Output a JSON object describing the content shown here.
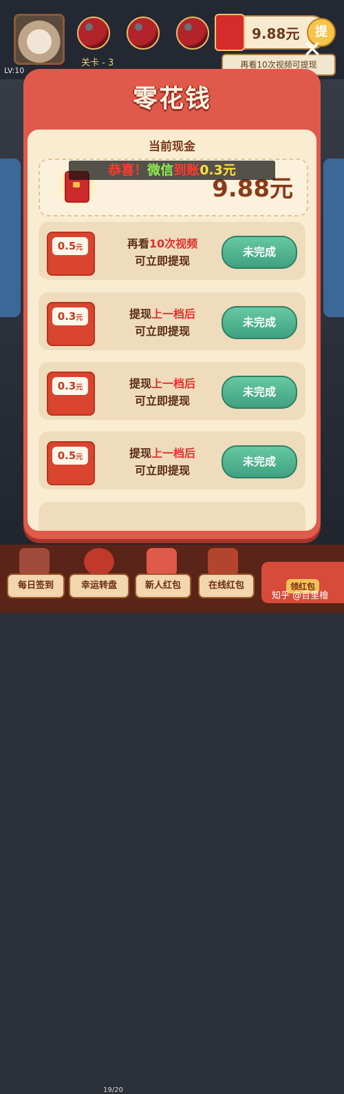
{
  "background": {
    "level": "LV:10",
    "stage": "关卡 - 3",
    "cash": "9.88元",
    "cash_tile": "提",
    "watch_note": "再看10次视频可提现",
    "progress": "19/20",
    "bottom_nav": [
      {
        "label": "每日签到"
      },
      {
        "label": "幸运转盘"
      },
      {
        "label": "新人红包"
      },
      {
        "label": "在线红包"
      }
    ],
    "claim_label": "领红包",
    "watermark": "知乎 @百里檜"
  },
  "modal": {
    "title": "零花钱",
    "current_label": "当前现金",
    "current_amount": "9.88元",
    "close_symbol": "✕"
  },
  "toast": {
    "part1": "恭喜！",
    "part2": "微信",
    "part3": "到账",
    "part4": "0.3元"
  },
  "tasks": [
    {
      "amount": "0.5",
      "unit": "元",
      "line1_a": "再看",
      "line1_b": "10次视频",
      "line2": "可立即提现",
      "button": "未完成"
    },
    {
      "amount": "0.3",
      "unit": "元",
      "line1_a": "提现",
      "line1_b": "上一档后",
      "line2": "可立即提现",
      "button": "未完成"
    },
    {
      "amount": "0.3",
      "unit": "元",
      "line1_a": "提现",
      "line1_b": "上一档后",
      "line2": "可立即提现",
      "button": "未完成"
    },
    {
      "amount": "0.5",
      "unit": "元",
      "line1_a": "提现",
      "line1_b": "上一档后",
      "line2": "可立即提现",
      "button": "未完成"
    }
  ]
}
